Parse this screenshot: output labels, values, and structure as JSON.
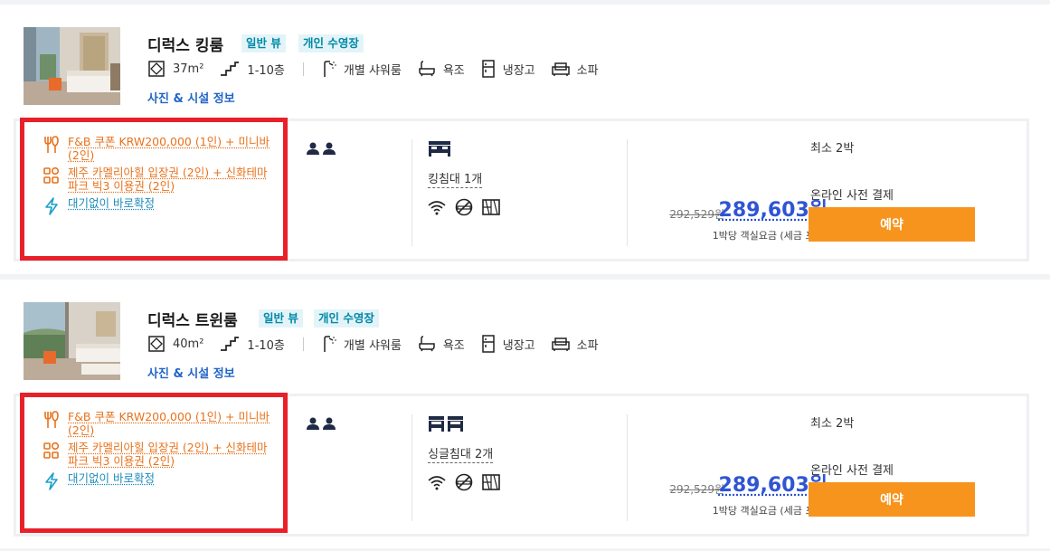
{
  "colors": {
    "accent_orange": "#f7941d",
    "price_blue": "#2f55d4",
    "tag_teal": "#0089a8",
    "benefit_orange": "#e8721c",
    "highlight_red": "#e8202a"
  },
  "rooms": [
    {
      "title": "디럭스 킹룸",
      "tags": [
        "일반 뷰",
        "개인 수영장"
      ],
      "size": "37m²",
      "floors": "1-10층",
      "amenities": [
        "개별 샤워룸",
        "욕조",
        "냉장고",
        "소파"
      ],
      "info_link": "사진 & 시설 정보",
      "benefits": [
        "F&B 쿠폰 KRW200,000 (1인) + 미니바 (2인)",
        "제주 카멜리아힐 입장권 (2인) + 신화테마파크 빅3 이용권 (2인)"
      ],
      "instant": "대기없이 바로확정",
      "bed": "킹침대 1개",
      "min_stay": "최소 2박",
      "pay": "온라인 사전 결제",
      "old_price": "292,529원",
      "price": "289,603원",
      "per_night": "1박당 객실요금 (세금 포함)",
      "book": "예약"
    },
    {
      "title": "디럭스 트윈룸",
      "tags": [
        "일반 뷰",
        "개인 수영장"
      ],
      "size": "40m²",
      "floors": "1-10층",
      "amenities": [
        "개별 샤워룸",
        "욕조",
        "냉장고",
        "소파"
      ],
      "info_link": "사진 & 시설 정보",
      "benefits": [
        "F&B 쿠폰 KRW200,000 (1인) + 미니바 (2인)",
        "제주 카멜리아힐 입장권 (2인) + 신화테마파크 빅3 이용권 (2인)"
      ],
      "instant": "대기없이 바로확정",
      "bed": "싱글침대 2개",
      "min_stay": "최소 2박",
      "pay": "온라인 사전 결제",
      "old_price": "292,529원",
      "price": "289,603원",
      "per_night": "1박당 객실요금 (세금 포함)",
      "book": "예약"
    }
  ]
}
